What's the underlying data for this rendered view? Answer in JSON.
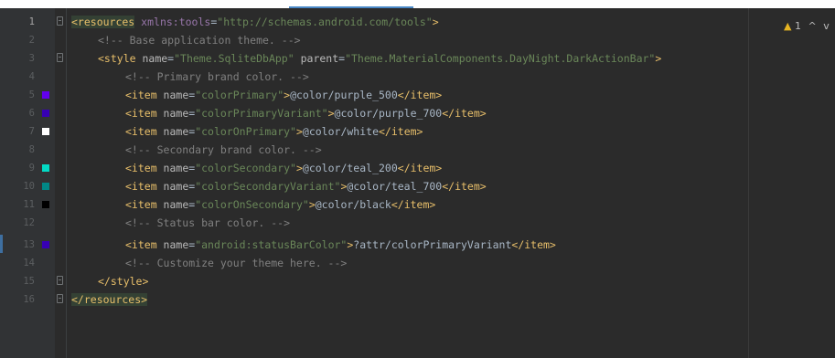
{
  "inspection": {
    "warning_count": "1",
    "up_chevron": "^",
    "down_chevron": "v"
  },
  "colors": {
    "purple_500": "#6200ee",
    "purple_700": "#3700b3",
    "white": "#ffffff",
    "teal_200": "#03dac5",
    "teal_700": "#018786",
    "black": "#000000"
  },
  "lines": [
    {
      "num": "1",
      "parts": [
        "<resources",
        " xmlns:tools",
        "=",
        "\"http://schemas.android.com/tools\"",
        ">"
      ]
    },
    {
      "num": "2",
      "text": "<!-- Base application theme. -->"
    },
    {
      "num": "3",
      "parts": [
        "<style",
        " name",
        "=",
        "\"Theme.SqliteDbApp\"",
        " parent",
        "=",
        "\"Theme.MaterialComponents.DayNight.DarkActionBar\"",
        ">"
      ]
    },
    {
      "num": "4",
      "text": "<!-- Primary brand color. -->"
    },
    {
      "num": "5",
      "parts": [
        "<item",
        " name",
        "=",
        "\"colorPrimary\"",
        ">",
        "@color/purple_500",
        "</item>"
      ]
    },
    {
      "num": "6",
      "parts": [
        "<item",
        " name",
        "=",
        "\"colorPrimaryVariant\"",
        ">",
        "@color/purple_700",
        "</item>"
      ]
    },
    {
      "num": "7",
      "parts": [
        "<item",
        " name",
        "=",
        "\"colorOnPrimary\"",
        ">",
        "@color/white",
        "</item>"
      ]
    },
    {
      "num": "8",
      "text": "<!-- Secondary brand color. -->"
    },
    {
      "num": "9",
      "parts": [
        "<item",
        " name",
        "=",
        "\"colorSecondary\"",
        ">",
        "@color/teal_200",
        "</item>"
      ]
    },
    {
      "num": "10",
      "parts": [
        "<item",
        " name",
        "=",
        "\"colorSecondaryVariant\"",
        ">",
        "@color/teal_700",
        "</item>"
      ]
    },
    {
      "num": "11",
      "parts": [
        "<item",
        " name",
        "=",
        "\"colorOnSecondary\"",
        ">",
        "@color/black",
        "</item>"
      ]
    },
    {
      "num": "12",
      "text": "<!-- Status bar color. -->"
    },
    {
      "num": "13",
      "parts": [
        "<item",
        " name",
        "=",
        "\"android:statusBarColor\"",
        ">",
        "?attr/colorPrimaryVariant",
        "</item>"
      ]
    },
    {
      "num": "14",
      "text": "<!-- Customize your theme here. -->"
    },
    {
      "num": "15",
      "parts": [
        "</style>"
      ]
    },
    {
      "num": "16",
      "parts": [
        "</resources>"
      ]
    }
  ]
}
